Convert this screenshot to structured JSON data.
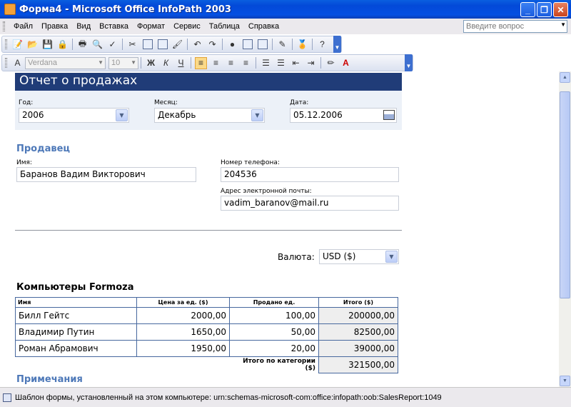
{
  "window": {
    "title": "Форма4 - Microsoft Office InfoPath 2003",
    "minimize": "_",
    "maximize": "❐",
    "close": "✕"
  },
  "menu": {
    "items": [
      "Файл",
      "Правка",
      "Вид",
      "Вставка",
      "Формат",
      "Сервис",
      "Таблица",
      "Справка"
    ],
    "ask_placeholder": "Введите вопрос"
  },
  "toolbar": {
    "standard_icons": [
      "new-icon",
      "open-icon",
      "save-icon",
      "permission-icon",
      "print-icon",
      "print-preview-icon",
      "spelling-icon",
      "cut-icon",
      "copy-icon",
      "paste-icon",
      "format-painter-icon",
      "undo-icon",
      "redo-icon",
      "insert-picture-icon",
      "insert-table-icon",
      "insert-image-icon",
      "design-task-icon",
      "digital-signature-icon",
      "help-icon"
    ],
    "font_name": "Verdana",
    "font_size": "10",
    "bold": "Ж",
    "italic": "К",
    "underline": "Ч"
  },
  "form": {
    "title": "Отчет о продажах",
    "year": {
      "label": "Год:",
      "value": "2006"
    },
    "month": {
      "label": "Месяц:",
      "value": "Декабрь"
    },
    "date": {
      "label": "Дата:",
      "value": "05.12.2006"
    },
    "seller_section": "Продавец",
    "name": {
      "label": "Имя:",
      "value": "Баранов Вадим Викторович"
    },
    "phone": {
      "label": "Номер телефона:",
      "value": "204536"
    },
    "email": {
      "label": "Адрес электронной почты:",
      "value": "vadim_baranov@mail.ru"
    },
    "currency": {
      "label": "Валюта:",
      "value": "USD ($)"
    },
    "category": "Компьютеры Formoza",
    "table": {
      "headers": [
        "Имя",
        "Цена за ед. ($)",
        "Продано ед.",
        "Итого ($)"
      ],
      "rows": [
        [
          "Билл Гейтс",
          "2000,00",
          "100,00",
          "200000,00"
        ],
        [
          "Владимир Путин",
          "1650,00",
          "50,00",
          "82500,00"
        ],
        [
          "Роман Абрамович",
          "1950,00",
          "20,00",
          "39000,00"
        ]
      ],
      "total_label": "Итого по категории ($)",
      "total_value": "321500,00"
    },
    "notes_section": "Примечания"
  },
  "status": {
    "text": "Шаблон формы, установленный на этом компьютере: urn:schemas-microsoft-com:office:infopath:oob:SalesReport:1049"
  }
}
